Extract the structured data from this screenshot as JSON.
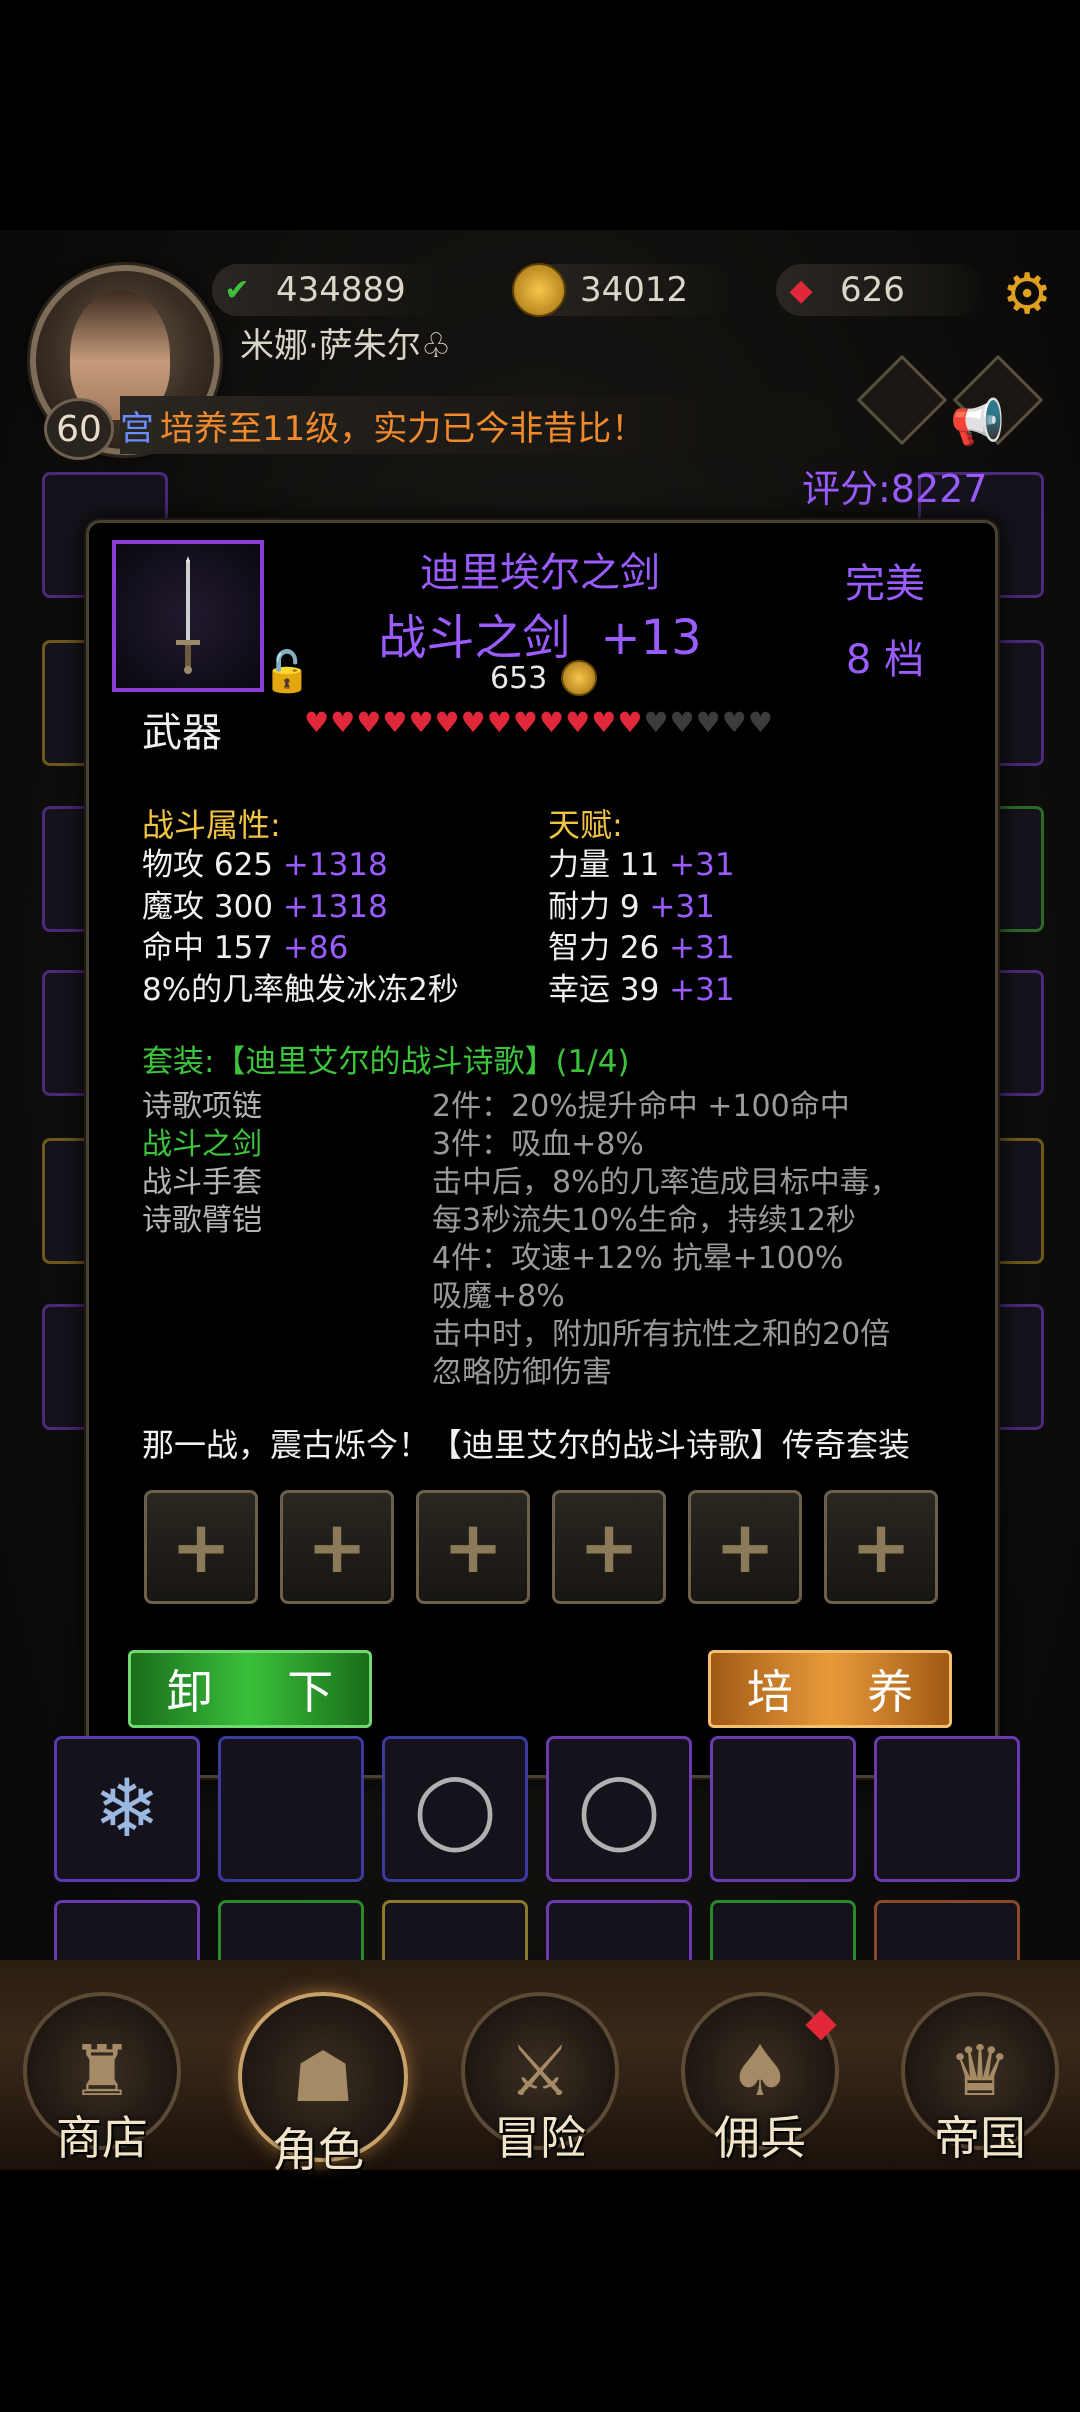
{
  "hud": {
    "level": "60",
    "player_name": "米娜·萨朱尔♧",
    "resources": [
      {
        "icon": "green-sword-icon",
        "value": "434889"
      },
      {
        "icon": "gold-coin-icon",
        "value": "34012"
      },
      {
        "icon": "red-gem-icon",
        "value": "626"
      }
    ],
    "marquee_tag": "宫",
    "marquee_text": "培养至11级，实力已今非昔比！",
    "score": "评分:8227"
  },
  "item": {
    "name": "迪里埃尔之剑",
    "type_name": "战斗之剑",
    "enhance": "+13",
    "quality": "完美",
    "tier": "8 档",
    "price": "653",
    "slot_label": "武器",
    "stars_filled": 13,
    "stars_total": 18,
    "combat_title": "战斗属性:",
    "talent_title": "天赋:",
    "combat_stats": [
      {
        "label": "物攻 625",
        "bonus": "+1318"
      },
      {
        "label": "魔攻 300",
        "bonus": "+1318"
      },
      {
        "label": "命中 157",
        "bonus": "+86"
      },
      {
        "label": "8%的几率触发冰冻2秒",
        "bonus": ""
      }
    ],
    "talents": [
      {
        "label": "力量 11",
        "bonus": "+31"
      },
      {
        "label": "耐力 9",
        "bonus": "+31"
      },
      {
        "label": "智力 26",
        "bonus": "+31"
      },
      {
        "label": "幸运 39",
        "bonus": "+31"
      }
    ],
    "set_title": "套装:【迪里艾尔的战斗诗歌】(1/4)",
    "set_pieces": [
      {
        "name": "诗歌项链",
        "active": false
      },
      {
        "name": "战斗之剑",
        "active": true
      },
      {
        "name": "战斗手套",
        "active": false
      },
      {
        "name": "诗歌臂铠",
        "active": false
      }
    ],
    "set_effects": [
      "2件：20%提升命中 +100命中",
      "3件：吸血+8%",
      "击中后，8%的几率造成目标中毒，",
      "每3秒流失10%生命，持续12秒",
      "4件：攻速+12% 抗晕+100%",
      "吸魔+8%",
      "击中时，附加所有抗性之和的20倍",
      "忽略防御伤害"
    ],
    "lore": "那一战，震古烁今！【迪里艾尔的战斗诗歌】传奇套装",
    "gem_slots": [
      "+",
      "+",
      "+",
      "+",
      "+",
      "+"
    ],
    "unequip_label": "卸 下",
    "upgrade_label": "培 养"
  },
  "nav": [
    {
      "label": "商店",
      "icon": "castle-icon",
      "active": false
    },
    {
      "label": "角色",
      "icon": "hooded-figure-icon",
      "active": true
    },
    {
      "label": "冒险",
      "icon": "crossed-swords-icon",
      "active": false
    },
    {
      "label": "佣兵",
      "icon": "cards-icon",
      "active": false
    },
    {
      "label": "帝国",
      "icon": "crown-icon",
      "active": false
    }
  ]
}
